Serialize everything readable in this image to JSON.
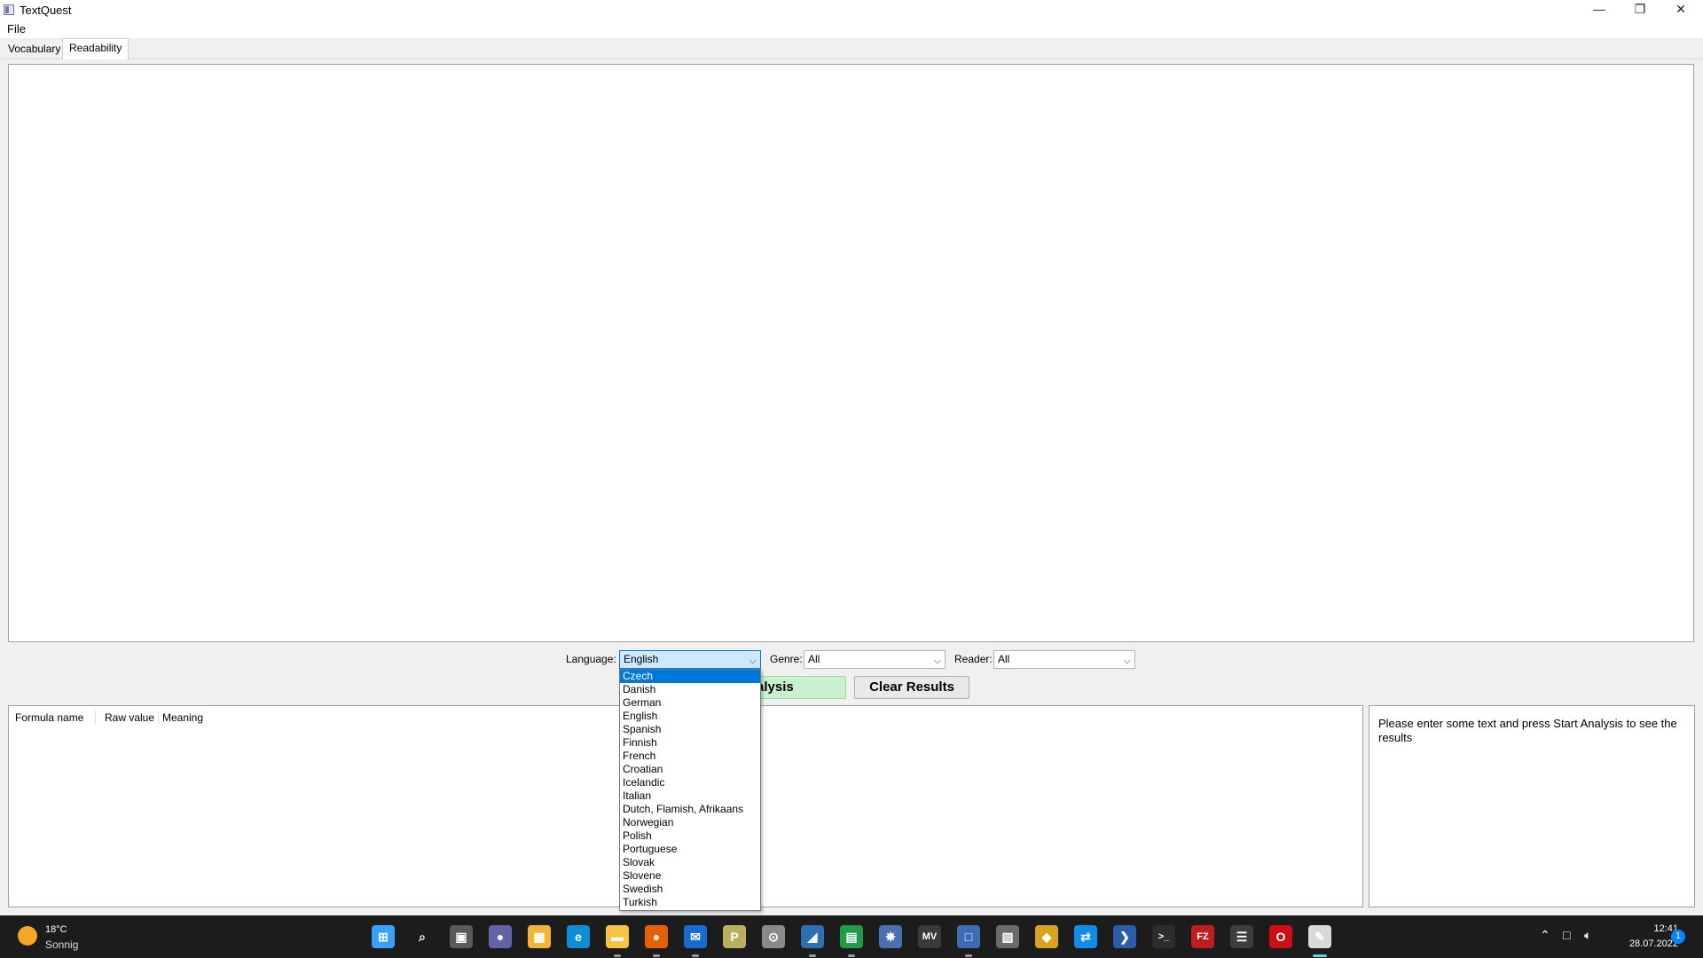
{
  "window": {
    "title": "TextQuest",
    "minimize": "—",
    "restore": "❐",
    "close": "✕"
  },
  "menu": {
    "file": "File"
  },
  "tabs": [
    {
      "label": "Vocabulary",
      "active": false
    },
    {
      "label": "Readability",
      "active": true
    }
  ],
  "controls": {
    "language_label": "Language:",
    "language_value": "English",
    "genre_label": "Genre:",
    "genre_value": "All",
    "reader_label": "Reader:",
    "reader_value": "All",
    "start_button": "Start Analysis",
    "clear_button": "Clear Results"
  },
  "language_options": [
    "Czech",
    "Danish",
    "German",
    "English",
    "Spanish",
    "Finnish",
    "French",
    "Croatian",
    "Icelandic",
    "Italian",
    "Dutch, Flamish, Afrikaans",
    "Norwegian",
    "Polish",
    "Portuguese",
    "Slovak",
    "Slovene",
    "Swedish",
    "Turkish"
  ],
  "highlighted_option": "Czech",
  "results_table": {
    "columns": [
      "Formula name",
      "Raw value",
      "Meaning"
    ]
  },
  "info_panel": {
    "text": "Please enter some text and press Start Analysis to see the results"
  },
  "taskbar": {
    "weather_temp": "18°C",
    "weather_desc": "Sonnig",
    "time": "12:41",
    "date": "28.07.2022",
    "notification_count": "1",
    "icons": [
      {
        "name": "start-icon",
        "color": "#3aa0ff",
        "glyph": "⊞"
      },
      {
        "name": "search-icon",
        "color": "#1c1c1c",
        "glyph": "⌕"
      },
      {
        "name": "task-view-icon",
        "color": "#5a5a5a",
        "glyph": "▣"
      },
      {
        "name": "teams-chat-icon",
        "color": "#6264a7",
        "glyph": "●"
      },
      {
        "name": "store-icon",
        "color": "#f2b632",
        "glyph": "▦"
      },
      {
        "name": "edge-icon",
        "color": "#0c8fd6",
        "glyph": "e"
      },
      {
        "name": "file-explorer-icon",
        "color": "#f6c342",
        "glyph": "▬"
      },
      {
        "name": "firefox-icon",
        "color": "#e66000",
        "glyph": "●"
      },
      {
        "name": "thunderbird-icon",
        "color": "#1a6bd1",
        "glyph": "✉"
      },
      {
        "name": "pdf-tool-icon",
        "color": "#b8b060",
        "glyph": "P"
      },
      {
        "name": "media-icon",
        "color": "#8a8a8a",
        "glyph": "⊙"
      },
      {
        "name": "editor-icon",
        "color": "#2c6fb5",
        "glyph": "◢"
      },
      {
        "name": "spreadsheet-icon",
        "color": "#1e9c4a",
        "glyph": "▤"
      },
      {
        "name": "network-tool-icon",
        "color": "#4b6fb0",
        "glyph": "✸"
      },
      {
        "name": "mv-app-icon",
        "color": "#3a3a3a",
        "glyph": "MV"
      },
      {
        "name": "remote-desktop-icon",
        "color": "#3b6cb4",
        "glyph": "□"
      },
      {
        "name": "gallery-icon",
        "color": "#6b6b6b",
        "glyph": "▧"
      },
      {
        "name": "git-icon",
        "color": "#d9a21b",
        "glyph": "◆"
      },
      {
        "name": "teamviewer-icon",
        "color": "#0e8ee9",
        "glyph": "⇄"
      },
      {
        "name": "powershell-icon",
        "color": "#2a5ea8",
        "glyph": "❯"
      },
      {
        "name": "terminal-icon",
        "color": "#2d2d2d",
        "glyph": ">_"
      },
      {
        "name": "filezilla-icon",
        "color": "#bf1e1e",
        "glyph": "FZ"
      },
      {
        "name": "notepad-icon",
        "color": "#3d3d3d",
        "glyph": "☰"
      },
      {
        "name": "opera-icon",
        "color": "#cc0f16",
        "glyph": "O"
      },
      {
        "name": "textquest-icon",
        "color": "#d9d9d9",
        "glyph": "✎"
      }
    ]
  }
}
